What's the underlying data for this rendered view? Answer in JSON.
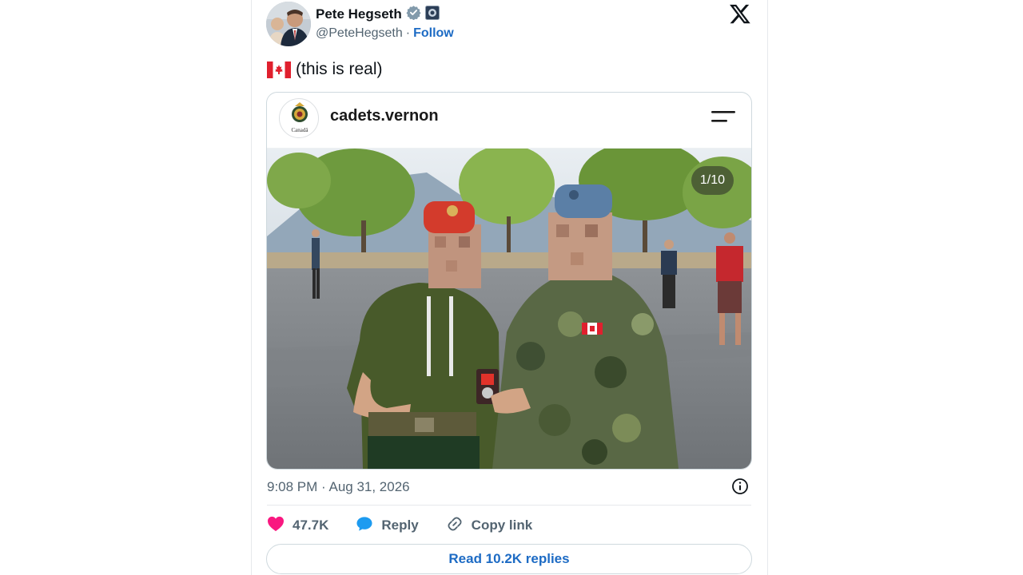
{
  "author": {
    "name": "Pete Hegseth",
    "handle": "@PeteHegseth",
    "separator": "·",
    "follow_label": "Follow",
    "verified_icon": "verified-badge-icon",
    "affiliation_icon": "affiliation-badge-icon"
  },
  "platform_icon": "x-logo-icon",
  "tweet": {
    "flag_icon": "canada-flag-icon",
    "text": "(this is real)"
  },
  "embed": {
    "account_name": "cadets.vernon",
    "avatar_caption": "Canadä",
    "menu_icon": "menu-icon",
    "photo_counter": "1/10",
    "photo_icon": "photo-image"
  },
  "timestamp": "9:08 PM · Aug 31, 2026",
  "info_icon": "info-icon",
  "actions": {
    "likes_count": "47.7K",
    "reply_label": "Reply",
    "copy_link_label": "Copy link"
  },
  "read_replies_label": "Read 10.2K replies",
  "colors": {
    "like": "#f91880",
    "reply": "#1d9bf0",
    "link_blue": "#1d6bc4",
    "muted_text": "#536471"
  }
}
